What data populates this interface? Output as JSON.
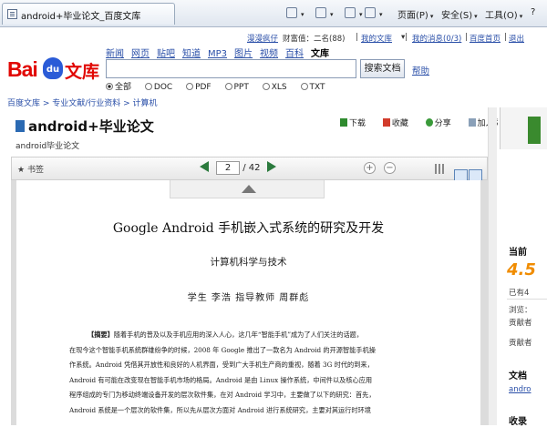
{
  "browser": {
    "tab_title": "android+毕业论文_百度文库",
    "toolbar": {
      "page": "页面(P)",
      "safety": "安全(S)",
      "tools": "工具(O)",
      "help": "?"
    }
  },
  "top_links": {
    "user": "漫漫疯仔",
    "wealth": "财富值：二名(88)",
    "my_library": "我的文库",
    "my_messages": "我的消息(0/3)",
    "baidu_home": "百度首页",
    "logout": "退出"
  },
  "logo": {
    "bai": "Bai",
    "du": "du",
    "wenku": "文库"
  },
  "nav": [
    "新闻",
    "网页",
    "贴吧",
    "知道",
    "MP3",
    "图片",
    "视频",
    "百科",
    "文库"
  ],
  "search": {
    "value": "",
    "button": "搜索文档",
    "help": "帮助",
    "filters": [
      "全部",
      "DOC",
      "PDF",
      "PPT",
      "XLS",
      "TXT"
    ],
    "selected_filter": "全部"
  },
  "breadcrumb": "百度文库 > 专业文献/行业资料 > 计算机",
  "document": {
    "title": "android+毕业论文",
    "subtitle": "android毕业论文",
    "actions": [
      "下载",
      "收藏",
      "分享",
      "加入文辑"
    ]
  },
  "viewer": {
    "bookmark": "书签",
    "page_current": "2",
    "page_total": "/ 42",
    "zoom_in": "+",
    "zoom_out": "−"
  },
  "paper": {
    "title": "Google Android 手机嵌入式系统的研究及开发",
    "department": "计算机科学与技术",
    "authors": "学生  李浩    指导教师  周群彪",
    "abstract_label": "【摘要】",
    "abstract_lines": [
      "随着手机的普及以及手机应用的深入人心，这几年“智能手机”成为了人们关注的话题，",
      "在现今这个智能手机系统群雄纷争的时候，2008 年 Google 推出了一款名为 Android 的开源智能手机操",
      "作系统。Android 凭借其开放性和良好的人机界面，受到广大手机生产商的重视，随着 3G 时代的到来，",
      "Android 有可能在改变现在智能手机市场的格局。Android 是由 Linux 操作系统，中间件以及核心应用",
      "程序组成的专门为移动终端设备开发的层次软件集，在对 Android 学习中，主要做了以下的研究：首先，",
      "Android 系统是一个层次的软件集，所以先从层次方面对 Android 进行系统研究，主要对其运行时环境"
    ]
  },
  "right_panel": {
    "current_label": "当前",
    "rating": "4.5",
    "reads": "已有4",
    "browse": "浏览：",
    "contributor": "贡献者",
    "contributor2": "贡献者",
    "doc_label": "文档",
    "doc_link": "andro",
    "favorites": "收录"
  }
}
